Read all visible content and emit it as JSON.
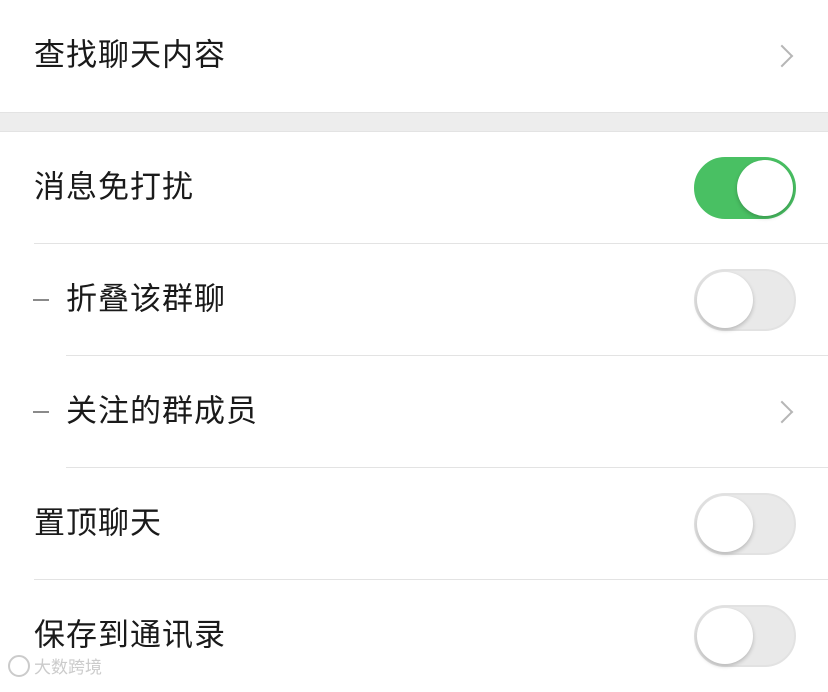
{
  "rows_top": [
    {
      "label": "查找聊天内容",
      "control": "chevron"
    }
  ],
  "rows_main": [
    {
      "label": "消息免打扰",
      "control": "toggle",
      "on": true
    },
    {
      "label": "折叠该群聊",
      "control": "toggle",
      "on": false,
      "sub": true
    },
    {
      "label": "关注的群成员",
      "control": "chevron",
      "sub": true
    },
    {
      "label": "置顶聊天",
      "control": "toggle",
      "on": false
    },
    {
      "label": "保存到通讯录",
      "control": "toggle",
      "on": false
    }
  ],
  "colors": {
    "toggle_on": "#49c063",
    "toggle_off": "#e9e9e9",
    "section_gap": "#ededed"
  },
  "icons": {
    "chevron": "chevron-right-icon",
    "sub_marker": "dash-icon"
  },
  "watermark": {
    "text": "大数跨境"
  }
}
